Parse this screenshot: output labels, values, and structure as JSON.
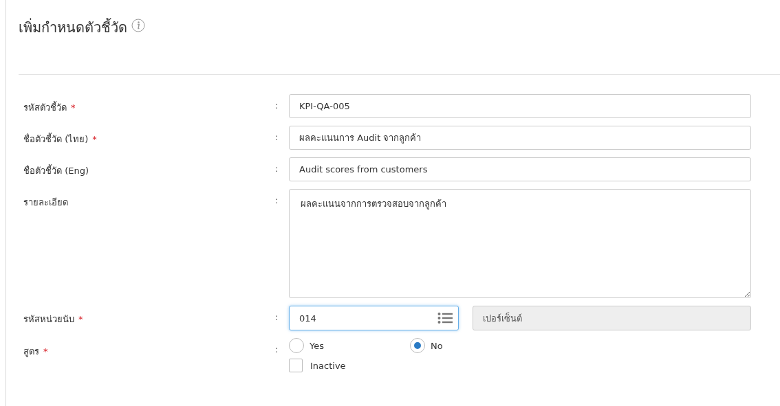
{
  "title": "เพิ่มกำหนดตัวชี้วัด",
  "fields": [
    {
      "kind": "input",
      "label": "รหัสตัวชี้วัด",
      "required": true,
      "separator": ":",
      "value": "KPI-QA-005"
    },
    {
      "kind": "input",
      "label": "ชื่อตัวชี้วัด (ไทย)",
      "required": true,
      "separator": ":",
      "value": "ผลคะแนนการ Audit จากลูกค้า"
    },
    {
      "kind": "input",
      "label": "ชื่อตัวชี้วัด (Eng)",
      "required": false,
      "separator": ":",
      "value": "Audit scores from customers"
    },
    {
      "kind": "textarea",
      "label": "รายละเอียด",
      "required": false,
      "separator": ":",
      "value": "ผลคะแนนจากการตรวจสอบจากลูกค้า"
    },
    {
      "kind": "lookup",
      "label": "รหัสหน่วยนับ",
      "required": true,
      "separator": ":",
      "value": "014",
      "display": "เปอร์เซ็นต์"
    },
    {
      "kind": "radio",
      "label": "สูตร",
      "required": true,
      "separator": ":",
      "options": [
        {
          "label": "Yes",
          "selected": false
        },
        {
          "label": "No",
          "selected": true
        }
      ],
      "checkbox": {
        "label": "Inactive",
        "checked": false
      }
    }
  ],
  "required_mark": "*"
}
